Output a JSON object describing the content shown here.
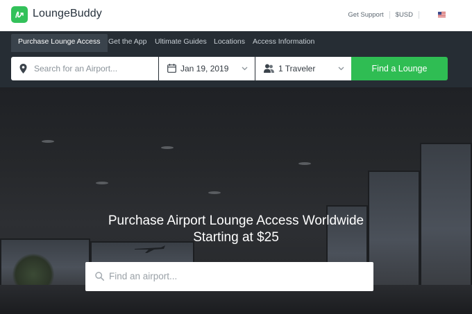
{
  "header": {
    "brand": "LoungeBuddy",
    "logo_icon": "loungebuddy-logo-icon",
    "links": [
      "Get Support",
      "$USD"
    ],
    "flag_icon": "us-flag-icon"
  },
  "nav": {
    "items": [
      {
        "label": "Purchase Lounge Access",
        "active": true
      },
      {
        "label": "Get the App",
        "active": false
      },
      {
        "label": "Ultimate Guides",
        "active": false
      },
      {
        "label": "Locations",
        "active": false
      },
      {
        "label": "Access Information",
        "active": false
      }
    ]
  },
  "search": {
    "airport_placeholder": "Search for an Airport...",
    "date_value": "Jan 19, 2019",
    "travelers_value": "1 Traveler",
    "button_label": "Find a Lounge",
    "accent_color": "#2fbd53"
  },
  "hero": {
    "title": "Purchase Airport Lounge Access Worldwide",
    "subtitle": "Starting at $25",
    "search_placeholder": "Find an airport..."
  }
}
